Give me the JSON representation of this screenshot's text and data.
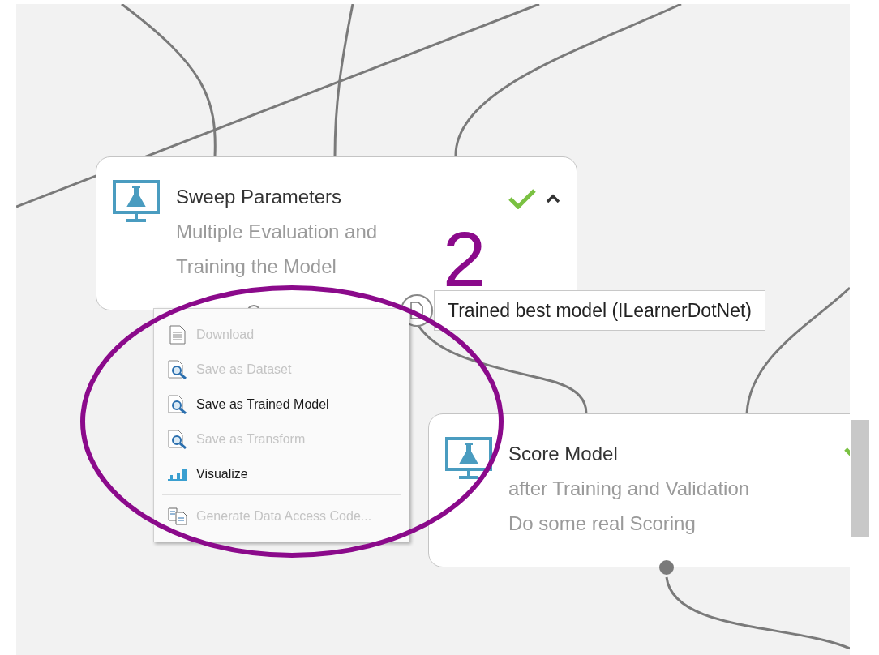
{
  "nodes": [
    {
      "title": "Sweep Parameters",
      "description": [
        "Multiple Evaluation and",
        "Training the Model"
      ],
      "completed": true,
      "expanded": true
    },
    {
      "title": "Score Model",
      "description": [
        "after Training and Validation",
        "Do some real Scoring"
      ],
      "completed": true
    }
  ],
  "output_tooltip": "Trained best model (ILearnerDotNet)",
  "context_menu": {
    "groups": [
      [
        {
          "label": "Download",
          "kind": "document",
          "disabled": true
        },
        {
          "label": "Save as Dataset",
          "kind": "preview",
          "disabled": true
        },
        {
          "label": "Save as Trained Model",
          "kind": "preview",
          "disabled": false
        },
        {
          "label": "Save as Transform",
          "kind": "preview",
          "disabled": true
        },
        {
          "label": "Visualize",
          "kind": "chart",
          "disabled": false
        }
      ],
      [
        {
          "label": "Generate Data Access Code...",
          "kind": "code",
          "disabled": true
        }
      ]
    ]
  },
  "annotation": {
    "label": "2"
  }
}
